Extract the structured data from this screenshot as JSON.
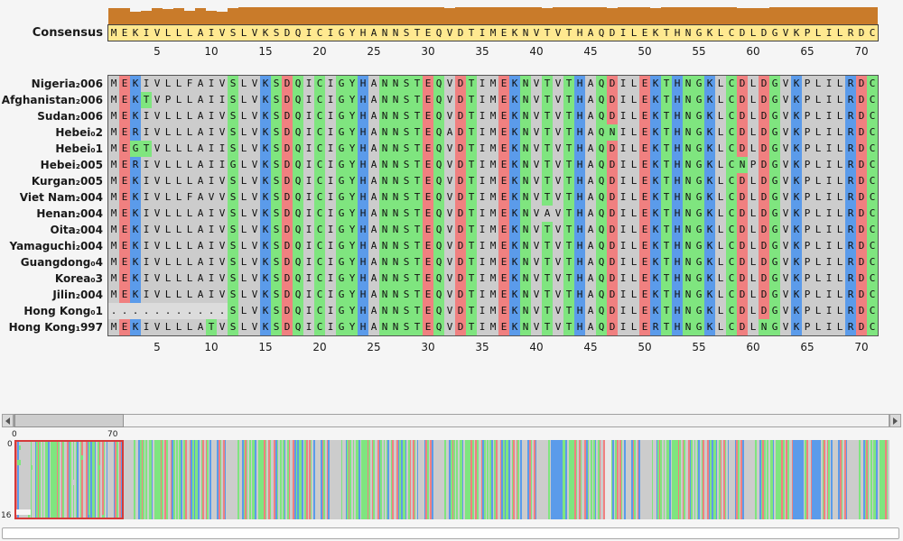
{
  "consensus": {
    "label": "Consensus",
    "sequence": "MEKIVLLLAIVSLVKSDQICIGYHANNSTEQVDTIMEKNVTVTHAQDILEKTHNGKLCDLDGVKPLILRDC"
  },
  "ruler_ticks": [
    5,
    10,
    15,
    20,
    25,
    30,
    35,
    40,
    45,
    50,
    55,
    60,
    65,
    70
  ],
  "sequences": [
    {
      "name": "Nigeria₂006",
      "seq": "MEKIVLLFAIVSLVKSDQICIGYHANNSTEQVDTIMEKNVTVTHAQDILEKTHNGKLCDLDGVKPLILRDC"
    },
    {
      "name": "Afghanistan₂006",
      "seq": "MEKTVPLLAIISLVKSDQICIGYHANNSTEQVDTIMEKNVTVTHAQDILEKTHNGKLCDLDGVKPLILRDC"
    },
    {
      "name": "Sudan₂006",
      "seq": "MEKIVLLLAIVSLVKSDQICIGYHANNSTEQVDTIMEKNVTVTHAQDILEKTHNGKLCDLDGVKPLILRDC"
    },
    {
      "name": "Hebei₀2",
      "seq": "MERIVLLLAIVSLVKSDQICIGYHANNSTEQADTIMEKNVTVTHAQNILEKTHNGKLCDLDGVKPLILRDC"
    },
    {
      "name": "Hebei₀1",
      "seq": "MEGTVLLLAIISLVKSDQICIGYHANNSTEQVDTIMEKNVTVTHAQDILEKTHNGKLCDLDGVKPLILRDC"
    },
    {
      "name": "Hebei₂005",
      "seq": "MERIVLLLAIIGLVKSDQICIGYHANNSTEQVDTIMEKNVTVTHAQDILEKTHNGKLCNPDGVKPLILRDC"
    },
    {
      "name": "Kurgan₂005",
      "seq": "MEKIVLLLAIVSLVKSDQICIGYHANNSTEQVDTIMEKNVTVTHAQDILEKTHNGKLCDLDGVKPLILRDC"
    },
    {
      "name": "Viet Nam₂004",
      "seq": "MEKIVLLFAVVSLVKSDQICIGYHANNSTEQVDTIMEKNVTVTHAQDILEKTHNGKLCDLDGVKPLILRDC"
    },
    {
      "name": "Henan₂004",
      "seq": "MEKIVLLLAIVSLVKSDQICIGYHANNSTEQVDTIMEKNVAVTHAQDILEKTHNGKLCDLDGVKPLILRDC"
    },
    {
      "name": "Oita₂004",
      "seq": "MEKIVLLLAIVSLVKSDQICIGYHANNSTEQVDTIMEKNVTVTHAQDILEKTHNGKLCDLDGVKPLILRDC"
    },
    {
      "name": "Yamaguchi₂004",
      "seq": "MEKIVLLLAIVSLVKSDQICIGYHANNSTEQVDTIMEKNVTVTHAQDILEKTHNGKLCDLDGVKPLILRDC"
    },
    {
      "name": "Guangdong₀4",
      "seq": "MEKIVLLLAIVSLVKSDQICIGYHANNSTEQVDTIMEKNVTVTHAQDILEKTHNGKLCDLDGVKPLILRDC"
    },
    {
      "name": "Korea₀3",
      "seq": "MEKIVLLLAIVSLVKSDQICIGYHANNSTEQVDTIMEKNVTVTHAQDILEKTHNGKLCDLDGVKPLILRDC"
    },
    {
      "name": "Jilin₂004",
      "seq": "MEKIVLLLAIVSLVKSDQICIGYHANNSTEQVDTIMEKNVTVTHAQDILEKTHNGKLCDLDGVKPLILRDC"
    },
    {
      "name": "Hong Kong₀1",
      "seq": "...........SLVKSDQICIGYHANNSTEQVDTIMEKNVTVTHAQDILEKTHNGKLCDLDGVKPLILRDC"
    },
    {
      "name": "Hong Kong₁997",
      "seq": "MEKIVLLLATVSLVKSDQICIGYHANNSTEQVDTIMEKNVTVTHAQDILERTHNGKLCDLNGVKPLILRDC"
    }
  ],
  "colors": {
    "histogram": "#c97b2a",
    "consensus_bg": "#ffe990",
    "gap_bg": "#dcdcdc",
    "viewport_rect": "#d43a3a",
    "residues": {
      "A": "#cccccc",
      "I": "#cccccc",
      "L": "#cccccc",
      "M": "#cccccc",
      "V": "#cccccc",
      "F": "#cccccc",
      "P": "#cccccc",
      "S": "#7fe57f",
      "T": "#7fe57f",
      "N": "#7fe57f",
      "Q": "#7fe57f",
      "G": "#7fe57f",
      "C": "#7fe57f",
      "Y": "#7fe57f",
      "K": "#5b9bea",
      "R": "#5b9bea",
      "H": "#5b9bea",
      "D": "#f08080",
      "E": "#f08080",
      ".": "#dcdcdc"
    }
  },
  "overview": {
    "col_start_label": "0",
    "col_end_label": "70",
    "row_start_label": "0",
    "row_end_label": "16"
  }
}
